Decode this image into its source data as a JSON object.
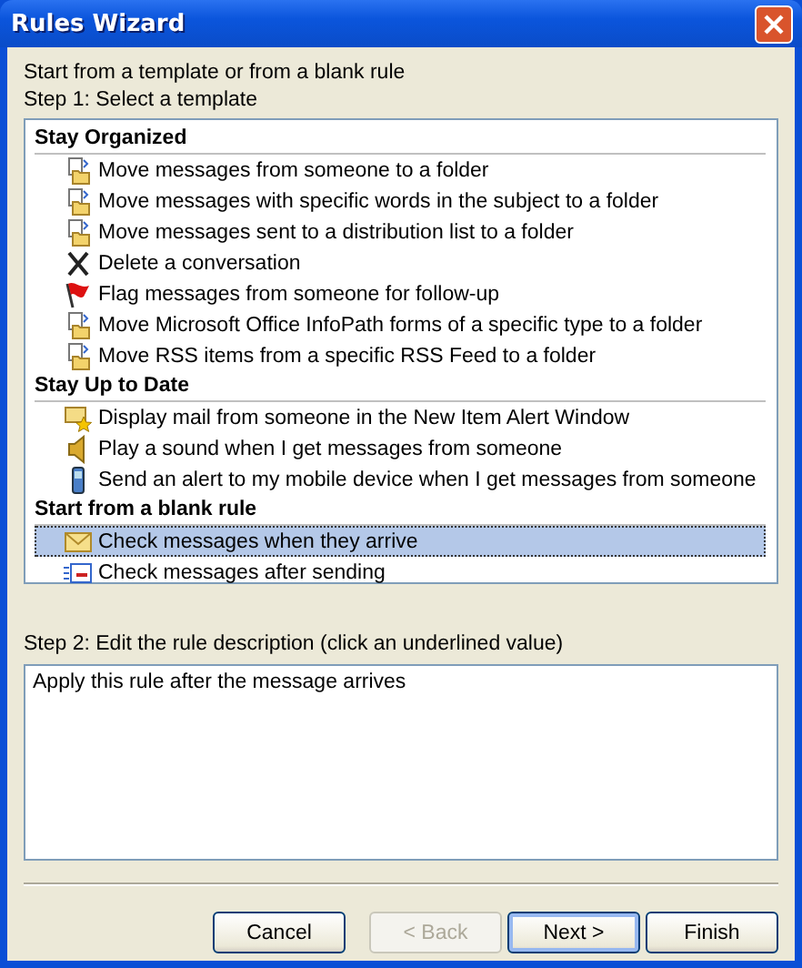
{
  "window": {
    "title": "Rules Wizard"
  },
  "intro": "Start from a template or from a blank rule",
  "step1_label": "Step 1: Select a template",
  "groups": [
    {
      "title": "Stay Organized",
      "items": [
        {
          "label": "Move messages from someone to a folder",
          "kind": "move",
          "selected": false
        },
        {
          "label": "Move messages with specific words in the subject to a folder",
          "kind": "move",
          "selected": false
        },
        {
          "label": "Move messages sent to a distribution list to a folder",
          "kind": "move",
          "selected": false
        },
        {
          "label": "Delete a conversation",
          "kind": "delete",
          "selected": false
        },
        {
          "label": "Flag messages from someone for follow-up",
          "kind": "flag",
          "selected": false
        },
        {
          "label": "Move Microsoft Office InfoPath forms of a specific type to a folder",
          "kind": "move",
          "selected": false
        },
        {
          "label": "Move RSS items from a specific RSS Feed to a folder",
          "kind": "move",
          "selected": false
        }
      ]
    },
    {
      "title": "Stay Up to Date",
      "items": [
        {
          "label": "Display mail from someone in the New Item Alert Window",
          "kind": "alert",
          "selected": false
        },
        {
          "label": "Play a sound when I get messages from someone",
          "kind": "sound",
          "selected": false
        },
        {
          "label": "Send an alert to my mobile device when I get messages from someone",
          "kind": "mobile",
          "selected": false
        }
      ]
    },
    {
      "title": "Start from a blank rule",
      "items": [
        {
          "label": "Check messages when they arrive",
          "kind": "arrive",
          "selected": true
        },
        {
          "label": "Check messages after sending",
          "kind": "send",
          "selected": false
        }
      ]
    }
  ],
  "step2_label": "Step 2: Edit the rule description (click an underlined value)",
  "description": "Apply this rule after the message arrives",
  "buttons": [
    {
      "label": "Cancel",
      "disabled": false,
      "default": false
    },
    {
      "label": "< Back",
      "disabled": true,
      "default": false
    },
    {
      "label": "Next >",
      "disabled": false,
      "default": true
    },
    {
      "label": "Finish",
      "disabled": false,
      "default": false
    }
  ]
}
